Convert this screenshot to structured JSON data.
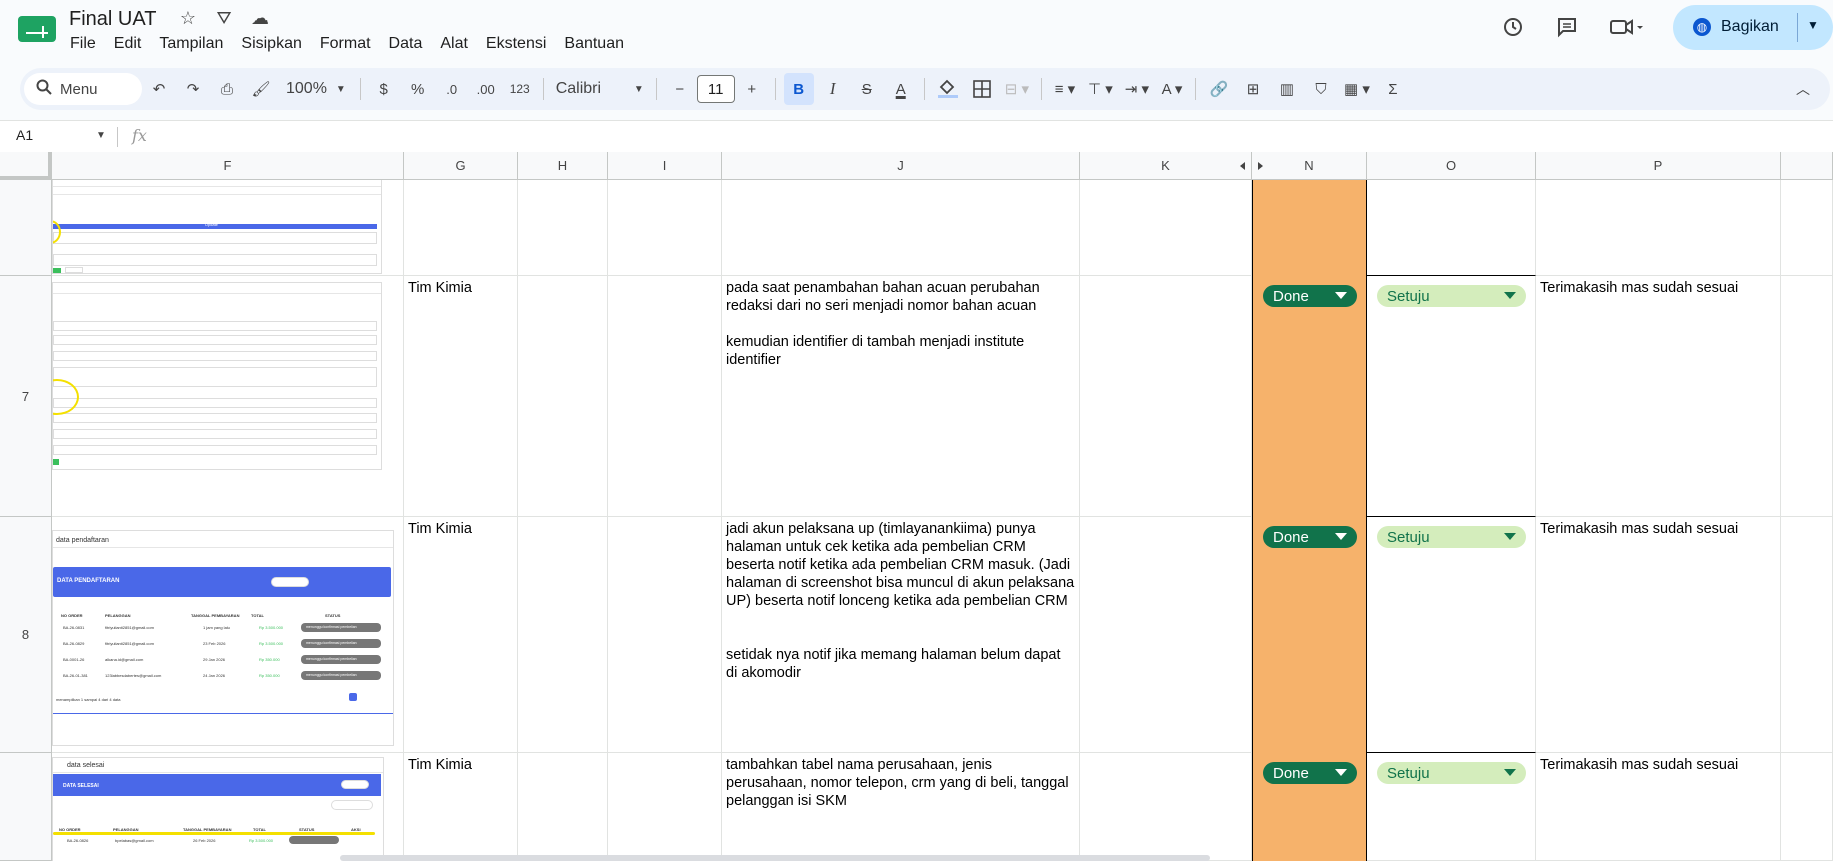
{
  "app": {
    "title": "Final UAT",
    "menu": [
      "File",
      "Edit",
      "Tampilan",
      "Sisipkan",
      "Format",
      "Data",
      "Alat",
      "Ekstensi",
      "Bantuan"
    ],
    "share_label": "Bagikan",
    "accent": "#c2e7ff"
  },
  "toolbar": {
    "search_label": "Menu",
    "zoom": "100%",
    "currency": "$",
    "percent": "%",
    "dec_decrease": ".0",
    "dec_increase": ".00",
    "number_format": "123",
    "font": "Calibri",
    "font_size": "11",
    "minus": "−",
    "plus": "+",
    "bold": "B",
    "italic": "I",
    "strike": "S",
    "text_color": "A",
    "sum": "Σ"
  },
  "formula_bar": {
    "cell_ref": "A1",
    "fx": "fx",
    "content": ""
  },
  "columns": [
    "F",
    "G",
    "H",
    "I",
    "J",
    "K",
    "N",
    "O",
    "P"
  ],
  "rows": [
    {
      "row_number": "",
      "G": "",
      "J": "",
      "N": null,
      "O": null,
      "P": ""
    },
    {
      "row_number": "7",
      "G": "Tim Kimia",
      "J": "pada saat penambahan bahan acuan perubahan redaksi dari no seri menjadi nomor bahan acuan\n\nkemudian identifier di tambah menjadi institute identifier",
      "N": "Done",
      "O": "Setuju",
      "P": "Terimakasih mas sudah sesuai"
    },
    {
      "row_number": "8",
      "G": "Tim Kimia",
      "J": "jadi akun pelaksana up (timlayanankiima) punya halaman untuk cek ketika ada pembelian CRM beserta notif ketika ada pembelian CRM masuk. (Jadi halaman di screenshot bisa muncul di akun pelaksana UP) beserta notif lonceng ketika ada pembelian CRM\n\n\nsetidak nya notif jika memang halaman belum dapat di akomodir",
      "N": "Done",
      "O": "Setuju",
      "P": "Terimakasih mas sudah sesuai"
    },
    {
      "row_number": "",
      "G": "Tim Kimia",
      "J": "tambahkan tabel nama perusahaan, jenis perusahaan, nomor telepon, crm yang di beli, tanggal pelanggan isi SKM",
      "N": "Done",
      "O": "Setuju",
      "P": "Terimakasih mas sudah sesuai"
    }
  ],
  "thumbnails": {
    "row7_title": "Update",
    "row8_title": "data pendaftaran",
    "row8_banner": "DATA PENDAFTARAN",
    "row8_headers": [
      "NO ORDER",
      "PELANGGAN",
      "TANGGAL PEMBAYARAN",
      "TOTAL",
      "STATUS"
    ],
    "row8_rows": [
      [
        "BA-26-0831",
        "fitriyulianti2851@gmail.com",
        "1 jam yang lalu",
        "Rp 3.500.000",
        "menunggu konfirmasi pembelian"
      ],
      [
        "BA-26-0829",
        "fitriyulianti2851@gmail.com",
        "23 Feb 2026",
        "Rp 3.500.000",
        "menunggu konfirmasi pembelian"
      ],
      [
        "BA-0001-26",
        "alkana.id@gmail.com",
        "29 Jan 2026",
        "Rp 350.000",
        "menunggu konfirmasi pembelian"
      ],
      [
        "BA-26-01-381",
        "123labbesdabertes@gmail.com",
        "24 Jan 2026",
        "Rp 350.000",
        "menunggu konfirmasi pembelian"
      ]
    ],
    "row8_footer": "menampilkan 1 sampai 4 dari 4 data",
    "row9_title": "data selesai",
    "row9_banner": "DATA SELESAI",
    "row9_headers": [
      "NO ORDER",
      "PELANGGAN",
      "TANGGAL PEMBAYARAN",
      "TOTAL",
      "STATUS",
      "AKSI"
    ],
    "row9_row": [
      "BA-26-0826",
      "bpelabas@gmail.com",
      "26 Feb 2026",
      "Rp 3.500.000"
    ]
  },
  "colors": {
    "done": "#11734b",
    "setuju": "#d4edbc",
    "orange_column": "#f6b26b"
  }
}
